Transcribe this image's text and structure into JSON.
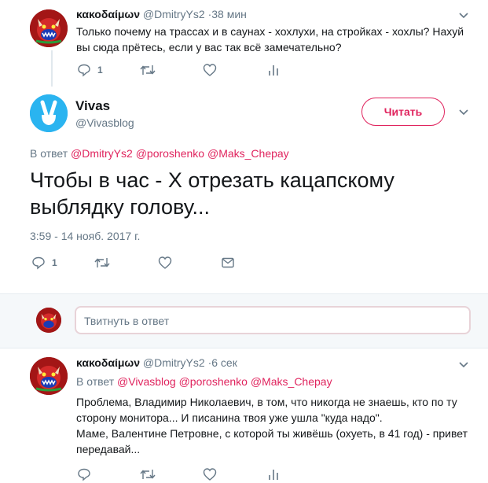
{
  "colors": {
    "accent": "#e0245e",
    "secondary": "#657786",
    "text": "#14171a",
    "background": "#ffffff",
    "separator": "#f5f8fa"
  },
  "tweet1": {
    "display_name": "κακοδαίμων",
    "handle": "@DmitryYs2",
    "time": "·38 мин",
    "text": "Только почему на трассах и в саунах - хохлухи, на стройках - хохлы? Нахуй вы сюда прётесь, если у вас так всё замечательно?",
    "reply_count": "1",
    "icons": [
      "reply-icon",
      "retweet-icon",
      "like-icon",
      "analytics-icon",
      "chevron-down-icon"
    ]
  },
  "main_tweet": {
    "display_name": "Vivas",
    "handle": "@Vivasblog",
    "follow_label": "Читать",
    "replying_to_label": "В ответ",
    "mentions": [
      "@DmitryYs2",
      "@poroshenko",
      "@Maks_Chepay"
    ],
    "text": "Чтобы в час - Х отрезать кацапскому выблядку голову...",
    "timestamp": "3:59 - 14 нояб. 2017 г.",
    "reply_count": "1",
    "icons": [
      "reply-icon",
      "retweet-icon",
      "like-icon",
      "message-icon",
      "chevron-down-icon"
    ]
  },
  "reply_composer": {
    "placeholder": "Твитнуть в ответ"
  },
  "tweet3": {
    "display_name": "κακοδαίμων",
    "handle": "@DmitryYs2",
    "time": "·6 сек",
    "replying_to_label": "В ответ",
    "mentions": [
      "@Vivasblog",
      "@poroshenko",
      "@Maks_Chepay"
    ],
    "text_line1": "Проблема, Владимир Николаевич, в том, что никогда не знаешь, кто по ту",
    "text_line2": "сторону монитора... И писанина твоя уже ушла \"куда надо\".",
    "text_line3": "Маме, Валентине Петровне, с которой ты живёшь (охуеть, в 41 год) - привет",
    "text_line4": "передавай..."
  }
}
